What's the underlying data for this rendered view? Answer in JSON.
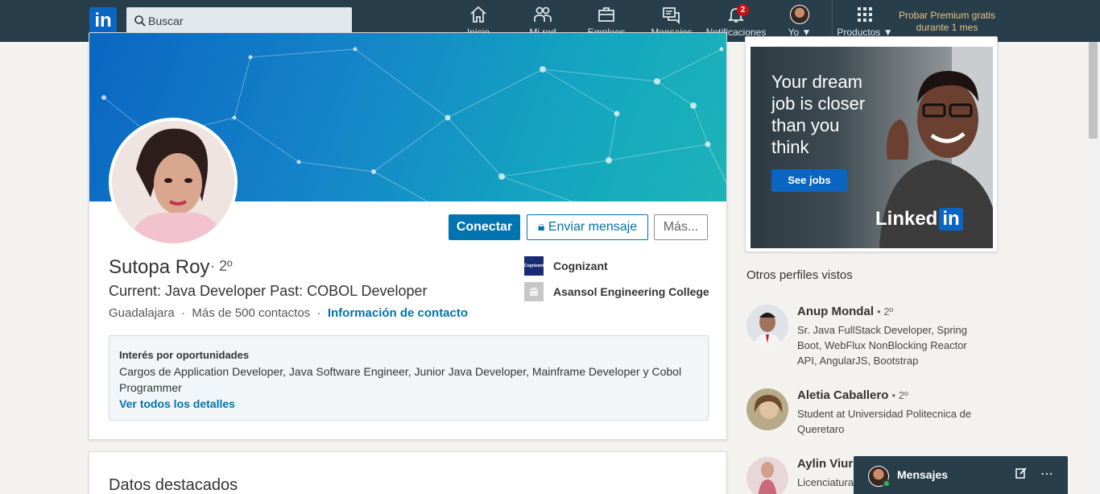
{
  "nav": {
    "logo": "in",
    "search_placeholder": "Buscar",
    "items": [
      {
        "label": "Inicio",
        "icon": "home-icon"
      },
      {
        "label": "Mi red",
        "icon": "network-icon"
      },
      {
        "label": "Empleos",
        "icon": "briefcase-icon"
      },
      {
        "label": "Mensajes",
        "icon": "messaging-icon"
      },
      {
        "label": "Notificaciones",
        "icon": "bell-icon",
        "badge": "2"
      },
      {
        "label": "Yo",
        "icon": "avatar"
      },
      {
        "label": "Productos",
        "icon": "grid-icon"
      }
    ],
    "premium_line1": "Probar Premium gratis",
    "premium_line2": "durante 1 mes"
  },
  "profile": {
    "name": "Sutopa Roy",
    "degree": "· 2º",
    "headline": "Current: Java Developer Past: COBOL Developer",
    "location": "Guadalajara",
    "connections": "Más de 500 contactos",
    "contact_info": "Información de contacto",
    "buttons": {
      "connect": "Conectar",
      "message": "Enviar mensaje",
      "more": "Más..."
    },
    "orgs": [
      {
        "name": "Cognizant",
        "logo_text": "Cognizant"
      },
      {
        "name": "Asansol Engineering College"
      }
    ],
    "opportunities": {
      "title": "Interés por oportunidades",
      "body": "Cargos de Application Developer, Java Software Engineer, Junior Java Developer, Mainframe Developer y Cobol Programmer",
      "link": "Ver todos los detalles"
    }
  },
  "highlights": {
    "title": "Datos destacados"
  },
  "ad": {
    "headline": "Your dream job is closer than you think",
    "cta": "See jobs",
    "brand": "Linked",
    "brand_in": "in"
  },
  "others": {
    "title": "Otros perfiles vistos",
    "people": [
      {
        "name": "Anup Mondal",
        "degree": "• 2º",
        "desc": "Sr. Java FullStack Developer, Spring Boot, WebFlux NonBlocking Reactor API, AngularJS, Bootstrap"
      },
      {
        "name": "Aletia Caballero",
        "degree": "• 2º",
        "desc": "Student at Universidad Politecnica de Queretaro"
      },
      {
        "name": "Aylin Viur",
        "degree": "",
        "desc": "Licenciatura"
      }
    ]
  },
  "messaging": {
    "title": "Mensajes"
  },
  "colors": {
    "nav_bg": "#283e4a",
    "accent": "#0073b1",
    "premium": "#e8c58a",
    "badge": "#cc1016"
  }
}
